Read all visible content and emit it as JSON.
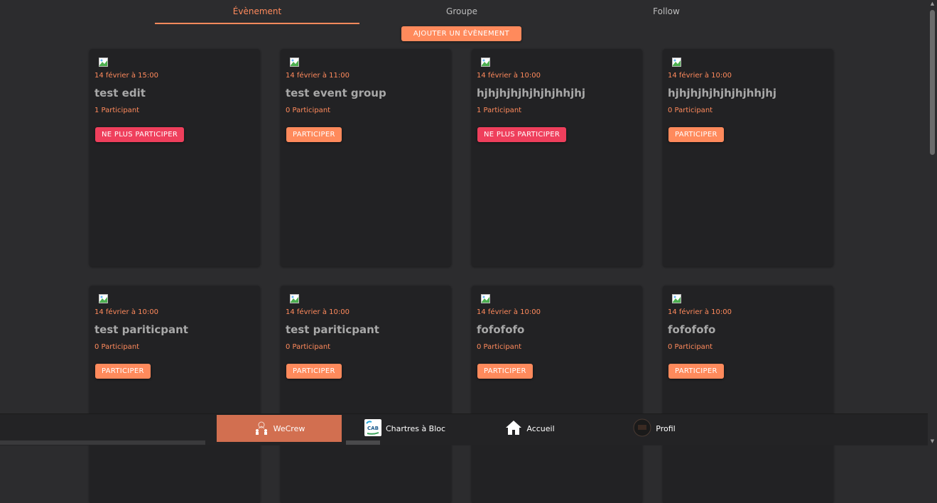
{
  "tabs": [
    {
      "label": "Évènement",
      "active": true
    },
    {
      "label": "Groupe",
      "active": false
    },
    {
      "label": "Follow",
      "active": false
    }
  ],
  "add_button_label": "AJOUTER UN ÉVÈNEMENT",
  "events": [
    {
      "date": "14 février à 15:00",
      "title": "test edit",
      "participants": "1 Participant",
      "button": "NE PLUS PARTICIPER",
      "joined": true
    },
    {
      "date": "14 février à 11:00",
      "title": "test event group",
      "participants": "0 Participant",
      "button": "PARTICIPER",
      "joined": false
    },
    {
      "date": "14 février à 10:00",
      "title": "hjhjhjhjhjhjhjhhjhj",
      "participants": "1 Participant",
      "button": "NE PLUS PARTICIPER",
      "joined": true
    },
    {
      "date": "14 février à 10:00",
      "title": "hjhjhjhjhjhjhjhhjhj",
      "participants": "0 Participant",
      "button": "PARTICIPER",
      "joined": false
    },
    {
      "date": "14 février à 10:00",
      "title": "test pariticpant",
      "participants": "0 Participant",
      "button": "PARTICIPER",
      "joined": false
    },
    {
      "date": "14 février à 10:00",
      "title": "test pariticpant",
      "participants": "0 Participant",
      "button": "PARTICIPER",
      "joined": false
    },
    {
      "date": "14 février à 10:00",
      "title": "fofofofo",
      "participants": "0 Participant",
      "button": "PARTICIPER",
      "joined": false
    },
    {
      "date": "14 février à 10:00",
      "title": "fofofofo",
      "participants": "0 Participant",
      "button": "PARTICIPER",
      "joined": false
    }
  ],
  "bottom_nav": [
    {
      "label": "WeCrew",
      "icon": "wecrew-logo-icon",
      "active": true
    },
    {
      "label": "Chartres à Bloc",
      "icon": "cab-logo-icon",
      "active": false
    },
    {
      "label": "Accueil",
      "icon": "home-icon",
      "active": false
    },
    {
      "label": "Profil",
      "icon": "avatar-icon",
      "active": false
    }
  ],
  "colors": {
    "accent": "#ff8a5c",
    "leave": "#ef3f5c",
    "background": "#2c2c2e",
    "card": "#222224",
    "nav_active": "#d26f50"
  }
}
